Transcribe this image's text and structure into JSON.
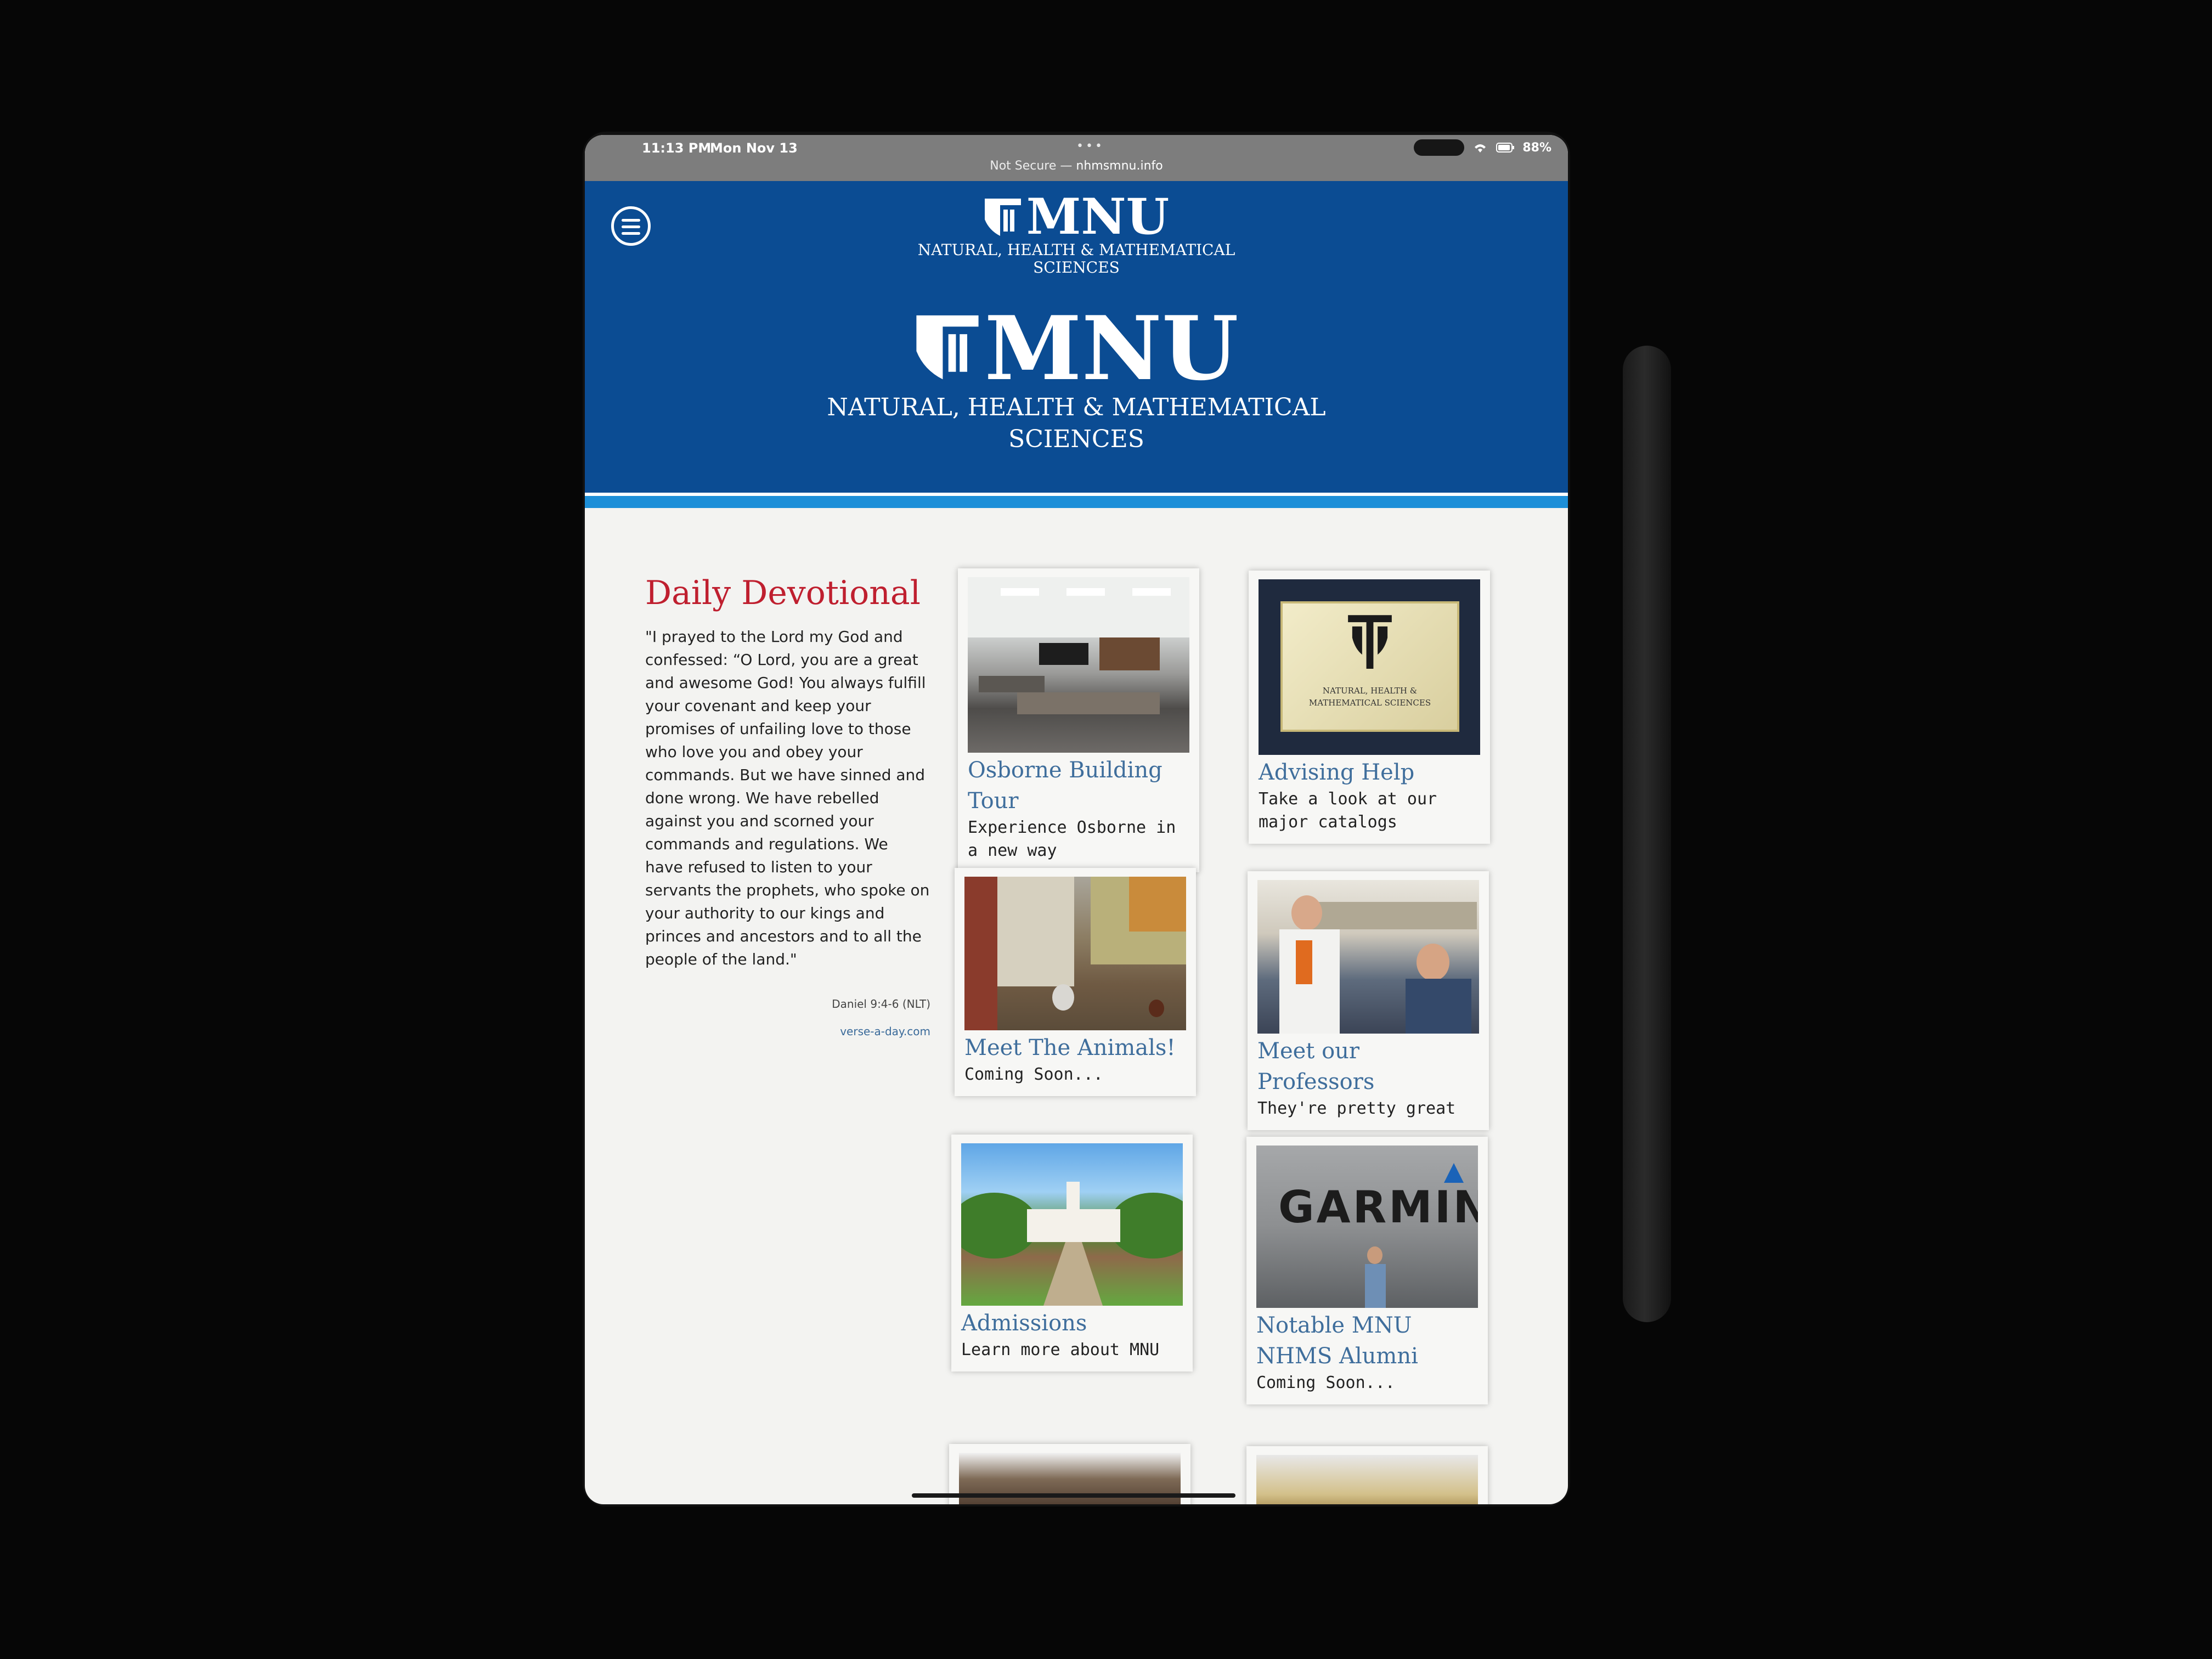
{
  "status_bar": {
    "time": "11:13 PM",
    "date": "Mon Nov 13",
    "dots": "•••",
    "security": "Not Secure —",
    "host": "nhmsmnu.info",
    "battery": "88%",
    "wifi_icon": "wifi-icon"
  },
  "header": {
    "logo_text": "MNU",
    "logo_subtitle_line1": "NATURAL, HEALTH & MATHEMATICAL",
    "logo_subtitle_line2": "SCIENCES",
    "brand_color": "#0b4c93",
    "accent_color": "#1d8fd8"
  },
  "devotional": {
    "title": "Daily Devotional",
    "text": "\"I prayed to the Lord my God and confessed: “O Lord, you are a great and awesome God! You always fulfill your covenant and keep your promises of unfailing love to those who love you and obey your commands. But we have sinned and done wrong. We have rebelled against you and scorned your commands and regulations. We have refused to listen to your servants the prophets, who spoke on your authority to our kings and princes and ancestors and to all the people of the land.\"",
    "reference": "Daniel 9:4-6 (NLT)",
    "source": "verse-a-day.com"
  },
  "cards": [
    {
      "title": "Osborne Building Tour",
      "desc": "Experience Osborne in a new way"
    },
    {
      "title": "Advising Help",
      "desc": "Take a look at our major catalogs"
    },
    {
      "title": "Meet The Animals!",
      "desc": "Coming Soon..."
    },
    {
      "title": "Meet our Professors",
      "desc": "They're pretty great"
    },
    {
      "title": "Admissions",
      "desc": "Learn more about MNU"
    },
    {
      "title": "Notable MNU NHMS Alumni",
      "desc": "Coming Soon..."
    }
  ],
  "images": {
    "plaque_line1": "NATURAL, HEALTH &",
    "plaque_line2": "MATHEMATICAL SCIENCES",
    "garmin_sign": "GARMIN"
  }
}
